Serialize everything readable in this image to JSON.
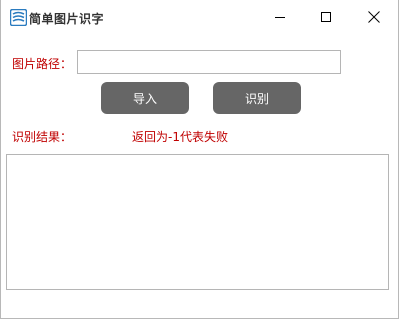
{
  "window": {
    "title": "简单图片识字",
    "app_icon": "text-recognition-logo-icon",
    "controls": {
      "minimize_icon": "minimize-icon",
      "maximize_icon": "maximize-icon",
      "close_icon": "close-icon"
    }
  },
  "form": {
    "path_label": "图片路径：",
    "path_value": "",
    "path_placeholder": "",
    "import_label": "导入",
    "recognize_label": "识别",
    "result_label": "识别结果：",
    "status_text": "返回为-1代表失败",
    "result_value": ""
  },
  "colors": {
    "label_red": "#c00000",
    "button_gray": "#666666",
    "button_text": "#ffffff",
    "icon_blue": "#2a7bbf"
  }
}
